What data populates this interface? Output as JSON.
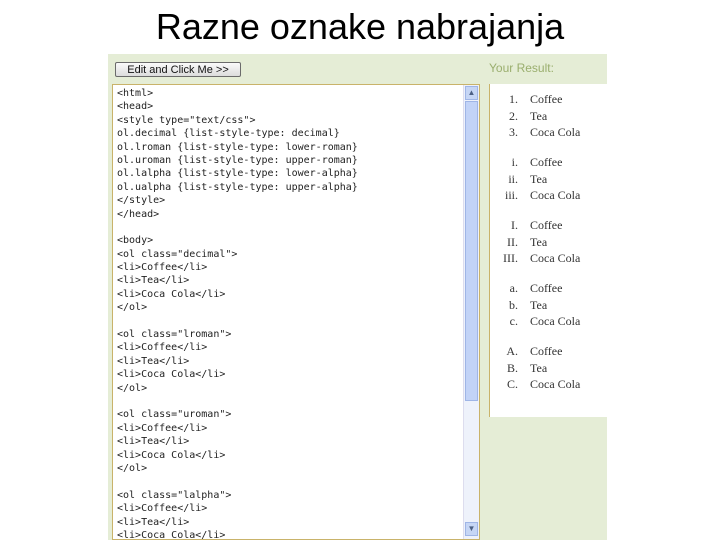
{
  "title": "Razne oznake nabrajanja",
  "editor": {
    "button_label": "Edit and Click Me >>",
    "code_lines": [
      "<html>",
      "<head>",
      "<style type=\"text/css\">",
      "ol.decimal {list-style-type: decimal}",
      "ol.lroman {list-style-type: lower-roman}",
      "ol.uroman {list-style-type: upper-roman}",
      "ol.lalpha {list-style-type: lower-alpha}",
      "ol.ualpha {list-style-type: upper-alpha}",
      "</style>",
      "</head>",
      "",
      "<body>",
      "<ol class=\"decimal\">",
      "<li>Coffee</li>",
      "<li>Tea</li>",
      "<li>Coca Cola</li>",
      "</ol>",
      "",
      "<ol class=\"lroman\">",
      "<li>Coffee</li>",
      "<li>Tea</li>",
      "<li>Coca Cola</li>",
      "</ol>",
      "",
      "<ol class=\"uroman\">",
      "<li>Coffee</li>",
      "<li>Tea</li>",
      "<li>Coca Cola</li>",
      "</ol>",
      "",
      "<ol class=\"lalpha\">",
      "<li>Coffee</li>",
      "<li>Tea</li>",
      "<li>Coca Cola</li>"
    ]
  },
  "result": {
    "label": "Your Result:",
    "lists": [
      {
        "markers": [
          "1.",
          "2.",
          "3."
        ],
        "items": [
          "Coffee",
          "Tea",
          "Coca Cola"
        ]
      },
      {
        "markers": [
          "i.",
          "ii.",
          "iii."
        ],
        "items": [
          "Coffee",
          "Tea",
          "Coca Cola"
        ]
      },
      {
        "markers": [
          "I.",
          "II.",
          "III."
        ],
        "items": [
          "Coffee",
          "Tea",
          "Coca Cola"
        ]
      },
      {
        "markers": [
          "a.",
          "b.",
          "c."
        ],
        "items": [
          "Coffee",
          "Tea",
          "Coca Cola"
        ]
      },
      {
        "markers": [
          "A.",
          "B.",
          "C."
        ],
        "items": [
          "Coffee",
          "Tea",
          "Coca Cola"
        ]
      }
    ]
  }
}
